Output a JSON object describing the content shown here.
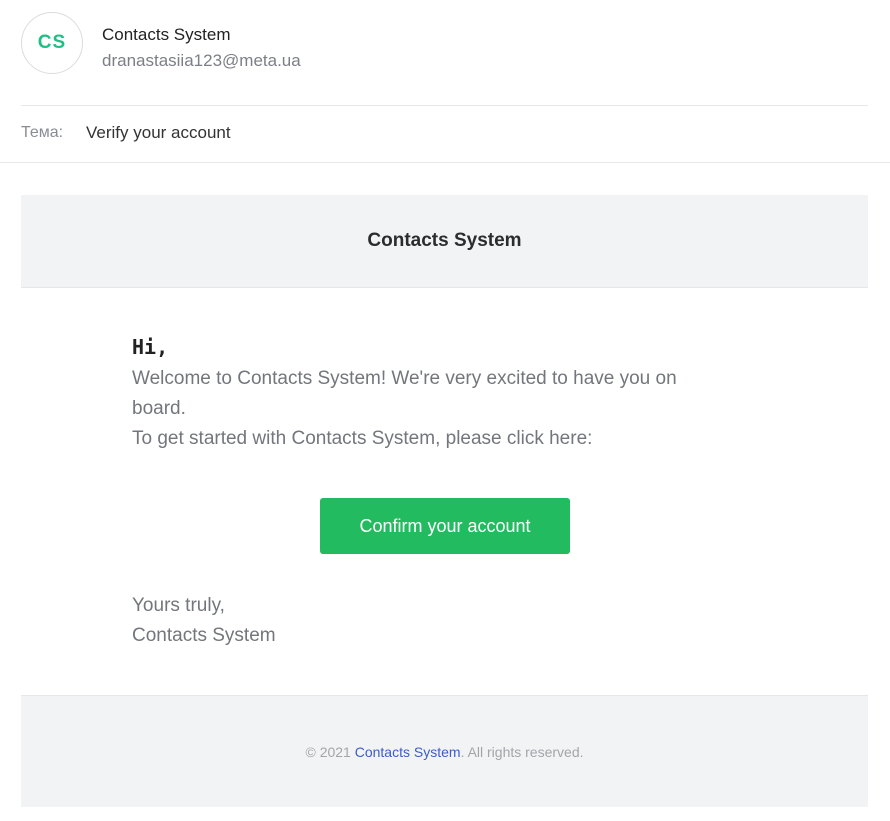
{
  "sender": {
    "avatar_initials": "CS",
    "avatar_color": "#1fbf86",
    "name": "Contacts System",
    "email": "dranastasiia123@meta.ua"
  },
  "subject": {
    "label": "Тема:",
    "value": "Verify your account"
  },
  "email": {
    "header_title": "Contacts System",
    "greeting": "Hi,",
    "paragraph_1": "Welcome to Contacts System! We're very excited to have you on board.",
    "paragraph_2": "To get started with Contacts System, please click here:",
    "button_label": "Confirm your account",
    "button_color": "#22bb5f",
    "signoff_line_1": "Yours truly,",
    "signoff_line_2": "Contacts System"
  },
  "footer": {
    "prefix": "© 2021 ",
    "link_text": "Contacts System",
    "suffix": ". All rights reserved.",
    "link_color": "#3b5dc9"
  }
}
